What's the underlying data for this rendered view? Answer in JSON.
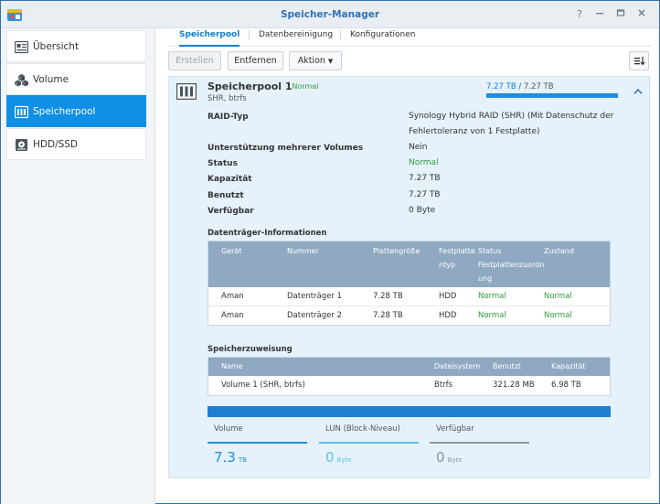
{
  "window": {
    "title": "Speicher-Manager"
  },
  "sidebar": {
    "items": [
      {
        "label": "Übersicht",
        "icon": "overview-icon"
      },
      {
        "label": "Volume",
        "icon": "volume-icon"
      },
      {
        "label": "Speicherpool",
        "icon": "storage-pool-icon",
        "active": true
      },
      {
        "label": "HDD/SSD",
        "icon": "hdd-icon"
      }
    ]
  },
  "tabs": [
    {
      "label": "Speicherpool",
      "active": true
    },
    {
      "label": "Datenbereinigung"
    },
    {
      "label": "Konfigurationen"
    }
  ],
  "toolbar": {
    "create": "Erstellen",
    "remove": "Entfernen",
    "action": "Aktion"
  },
  "pool": {
    "name": "Speicherpool 1",
    "status": "- Normal",
    "subtitle": "SHR, btrfs",
    "used_text": "7.27 TB",
    "total_text": " / 7.27 TB",
    "usage_fraction": 1.0
  },
  "properties": [
    {
      "label": "RAID-Typ",
      "value": "Synology Hybrid RAID (SHR) (Mit Datenschutz der Fehlertoleranz von 1 Festplatte)"
    },
    {
      "label": "Unterstützung mehrerer Volumes",
      "value": "Nein"
    },
    {
      "label": "Status",
      "value": "Normal"
    },
    {
      "label": "Kapazität",
      "value": "7.27 TB"
    },
    {
      "label": "Benutzt",
      "value": "7.27 TB"
    },
    {
      "label": "Verfügbar",
      "value": "0 Byte"
    }
  ],
  "disks": {
    "title": "Datenträger-Informationen",
    "headers": [
      "Gerät",
      "Nummer",
      "Plattengröße",
      "Festplatte ntyp",
      "Status Festplattenzuordn ung",
      "Zustand"
    ],
    "rows": [
      [
        "Aman",
        "Datenträger 1",
        "7.28 TB",
        "HDD",
        "Normal",
        "Normal"
      ],
      [
        "Aman",
        "Datenträger 2",
        "7.28 TB",
        "HDD",
        "Normal",
        "Normal"
      ]
    ]
  },
  "allocation": {
    "title": "Speicherzuweisung",
    "headers": [
      "Name",
      "Dateisystem",
      "Benutzt",
      "Kapazität"
    ],
    "rows": [
      [
        "Volume 1 (SHR, btrfs)",
        "Btrfs",
        "321.28 MB",
        "6.98 TB"
      ]
    ]
  },
  "summary": [
    {
      "label": "Volume",
      "value": "7.3",
      "unit": "TB",
      "color": "#1e8de3"
    },
    {
      "label": "LUN (Block-Niveau)",
      "value": "0",
      "unit": "Byte",
      "color": "#5cc0f0"
    },
    {
      "label": "Verfügbar",
      "value": "0",
      "unit": "Byte",
      "color": "#8a96a3"
    }
  ],
  "colors": {
    "accent": "#0f8fe5",
    "normal": "#2f9a3d",
    "table_header": "#8fa9c2"
  }
}
